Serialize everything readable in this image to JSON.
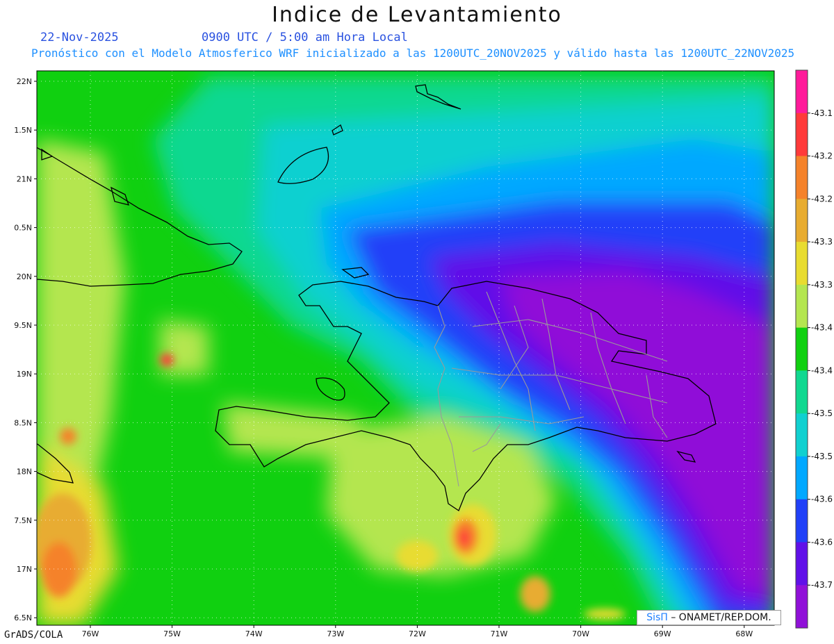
{
  "header": {
    "title": "Indice de Levantamiento",
    "date": "22-Nov-2025",
    "time": "0900 UTC / 5:00 am Hora Local",
    "description": "Pronóstico con el Modelo Atmosferico WRF inicializado a las 1200UTC_20NOV2025 y válido hasta las  1200UTC_22NOV2025"
  },
  "map": {
    "lat_ticks": [
      "22N",
      "1.5N",
      "21N",
      "0.5N",
      "20N",
      "9.5N",
      "19N",
      "8.5N",
      "18N",
      "7.5N",
      "17N",
      "6.5N"
    ],
    "lon_ticks": [
      "76W",
      "75W",
      "74W",
      "73W",
      "72W",
      "71W",
      "70W",
      "69W",
      "68W"
    ]
  },
  "colorbar": {
    "colors": [
      "#ff1a9a",
      "#ff3a3a",
      "#f5822a",
      "#e8ac30",
      "#e8dc30",
      "#b4e650",
      "#10d010",
      "#10d890",
      "#10d0d0",
      "#00a8ff",
      "#2040f8",
      "#6010e8",
      "#9010d8"
    ],
    "labels": [
      "-43.1",
      "-43.2",
      "-43.2",
      "-43.3",
      "-43.3",
      "-43.4",
      "-43.4",
      "-43.5",
      "-43.5",
      "-43.6",
      "-43.6",
      "-43.7"
    ]
  },
  "footer": {
    "software": "GrADS/COLA",
    "credit_brand": "SisΠ",
    "credit_text": "– ONAMET/REP.DOM."
  }
}
